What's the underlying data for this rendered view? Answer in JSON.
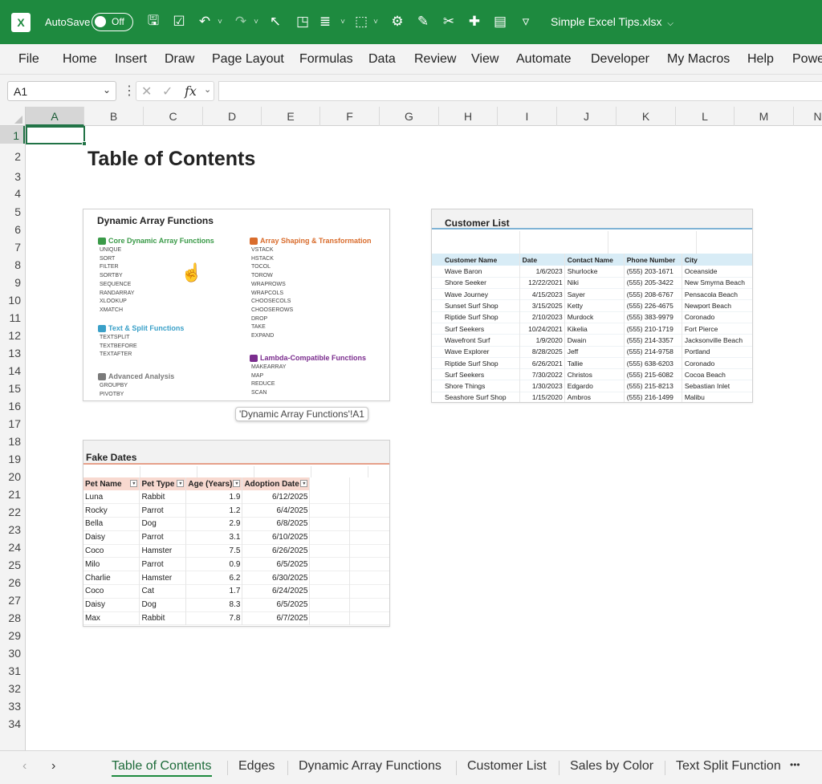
{
  "titlebar": {
    "autosave_label": "AutoSave",
    "autosave_state": "Off",
    "filename": "Simple Excel Tips.xlsx",
    "bg_color": "#1e8a3f",
    "icons": [
      "save-icon",
      "checklist-icon",
      "undo-icon",
      "dropdown-icon",
      "redo-icon",
      "dropdown-icon",
      "cursor-icon",
      "shapes-icon",
      "align-icon",
      "dropdown-icon",
      "group-icon",
      "dropdown-icon",
      "settings-icon",
      "form-icon",
      "crop-icon",
      "move-icon",
      "page-icon",
      "customize-icon"
    ]
  },
  "ribbon_tabs": [
    "File",
    "Home",
    "Insert",
    "Draw",
    "Page Layout",
    "Formulas",
    "Data",
    "Review",
    "View",
    "Automate",
    "Developer",
    "My Macros",
    "Help",
    "Powe"
  ],
  "formula_bar": {
    "name_box": "A1",
    "fx": "fx",
    "value": ""
  },
  "columns": [
    "A",
    "B",
    "C",
    "D",
    "E",
    "F",
    "G",
    "H",
    "I",
    "J",
    "K",
    "L",
    "M",
    "N"
  ],
  "rows": [
    "1",
    "2",
    "3",
    "4",
    "5",
    "6",
    "7",
    "8",
    "9",
    "10",
    "11",
    "12",
    "13",
    "14",
    "15",
    "16",
    "17",
    "18",
    "19",
    "20",
    "21",
    "22",
    "23",
    "24",
    "25",
    "26",
    "27",
    "28",
    "29",
    "30",
    "31",
    "32",
    "33",
    "34"
  ],
  "sheet_title": "Table of Contents",
  "dynamic_panel": {
    "title": "Dynamic Array Functions",
    "sections": [
      {
        "heading": "Core Dynamic Array Functions",
        "color": "#3a9a48",
        "icon": "check-icon",
        "items": [
          "UNIQUE",
          "SORT",
          "FILTER",
          "SORTBY",
          "SEQUENCE",
          "RANDARRAY",
          "XLOOKUP",
          "XMATCH"
        ]
      },
      {
        "heading": "Text & Split Functions",
        "color": "#3aa0c8",
        "icon": "text-icon",
        "items": [
          "TEXTSPLIT",
          "TEXTBEFORE",
          "TEXTAFTER"
        ]
      },
      {
        "heading": "Advanced Analysis",
        "color": "#7a7a7a",
        "icon": "chart-icon",
        "items": [
          "GROUPBY",
          "PIVOTBY"
        ]
      },
      {
        "heading": "Array Shaping & Transformation",
        "color": "#d96c2c",
        "icon": "layers-icon",
        "items": [
          "VSTACK",
          "HSTACK",
          "TOCOL",
          "TOROW",
          "WRAPROWS",
          "WRAPCOLS",
          "CHOOSECOLS",
          "CHOOSEROWS",
          "DROP",
          "TAKE",
          "EXPAND"
        ]
      },
      {
        "heading": "Lambda-Compatible Functions",
        "color": "#7b2d8e",
        "icon": "lambda-icon",
        "items": [
          "MAKEARRAY",
          "MAP",
          "REDUCE",
          "SCAN"
        ]
      }
    ]
  },
  "tooltip": "'Dynamic Array Functions'!A1",
  "customer_panel": {
    "title": "Customer List",
    "header_color": "#d8ecf6",
    "headers": [
      "Customer Name",
      "Date",
      "Contact Name",
      "Phone Number",
      "City"
    ],
    "rows": [
      [
        "Wave Baron",
        "1/6/2023",
        "Shurlocke",
        "(555) 203-1671",
        "Oceanside"
      ],
      [
        "Shore Seeker",
        "12/22/2021",
        "Niki",
        "(555) 205-3422",
        "New Smyrna Beach"
      ],
      [
        "Wave Journey",
        "4/15/2023",
        "Sayer",
        "(555) 208-6767",
        "Pensacola Beach"
      ],
      [
        "Sunset Surf Shop",
        "3/15/2025",
        "Ketty",
        "(555) 226-4675",
        "Newport Beach"
      ],
      [
        "Riptide Surf Shop",
        "2/10/2023",
        "Murdock",
        "(555) 383-9979",
        "Coronado"
      ],
      [
        "Surf Seekers",
        "10/24/2021",
        "Kikelia",
        "(555) 210-1719",
        "Fort Pierce"
      ],
      [
        "Wavefront Surf",
        "1/9/2020",
        "Dwain",
        "(555) 214-3357",
        "Jacksonville Beach"
      ],
      [
        "Wave Explorer",
        "8/28/2025",
        "Jeff",
        "(555) 214-9758",
        "Portland"
      ],
      [
        "Riptide Surf Shop",
        "6/26/2021",
        "Tallie",
        "(555) 638-6203",
        "Coronado"
      ],
      [
        "Surf Seekers",
        "7/30/2022",
        "Christos",
        "(555) 215-6082",
        "Cocoa Beach"
      ],
      [
        "Shore Things",
        "1/30/2023",
        "Edgardo",
        "(555) 215-8213",
        "Sebastian Inlet"
      ],
      [
        "Seashore Surf Shop",
        "1/15/2020",
        "Ambros",
        "(555) 216-1499",
        "Malibu"
      ]
    ]
  },
  "dates_panel": {
    "title": "Fake Dates",
    "header_color": "#f8d9d0",
    "headers": [
      "Pet Name",
      "Pet Type",
      "Age (Years)",
      "Adoption Date"
    ],
    "rows": [
      [
        "Luna",
        "Rabbit",
        "1.9",
        "6/12/2025"
      ],
      [
        "Rocky",
        "Parrot",
        "1.2",
        "6/4/2025"
      ],
      [
        "Bella",
        "Dog",
        "2.9",
        "6/8/2025"
      ],
      [
        "Daisy",
        "Parrot",
        "3.1",
        "6/10/2025"
      ],
      [
        "Coco",
        "Hamster",
        "7.5",
        "6/26/2025"
      ],
      [
        "Milo",
        "Parrot",
        "0.9",
        "6/5/2025"
      ],
      [
        "Charlie",
        "Hamster",
        "6.2",
        "6/30/2025"
      ],
      [
        "Coco",
        "Cat",
        "1.7",
        "6/24/2025"
      ],
      [
        "Daisy",
        "Dog",
        "8.3",
        "6/5/2025"
      ],
      [
        "Max",
        "Rabbit",
        "7.8",
        "6/7/2025"
      ]
    ]
  },
  "sheet_tabs": [
    "Table of Contents",
    "Edges",
    "Dynamic Array Functions",
    "Customer List",
    "Sales by Color",
    "Text Split Function"
  ],
  "active_tab": "Table of Contents",
  "tab_more": "•••"
}
